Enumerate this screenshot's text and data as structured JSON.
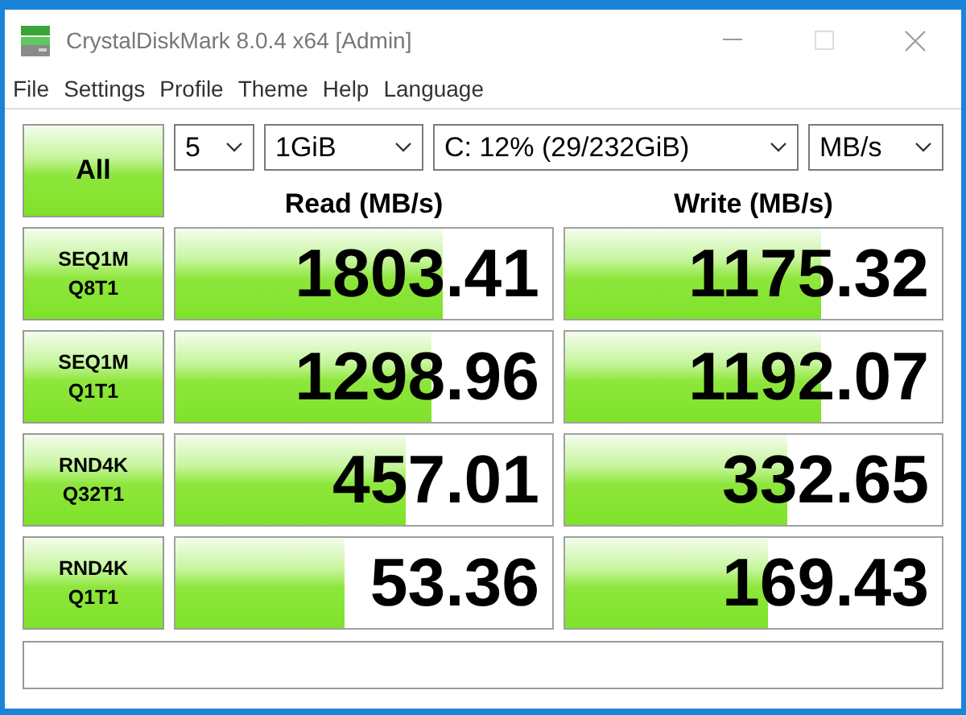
{
  "window": {
    "title": "CrystalDiskMark 8.0.4 x64 [Admin]"
  },
  "menu": [
    "File",
    "Settings",
    "Profile",
    "Theme",
    "Help",
    "Language"
  ],
  "all_button": "All",
  "selects": [
    {
      "value": "5"
    },
    {
      "value": "1GiB"
    },
    {
      "value": "C: 12% (29/232GiB)"
    },
    {
      "value": "MB/s"
    }
  ],
  "columns": [
    "Read (MB/s)",
    "Write (MB/s)"
  ],
  "rows": [
    {
      "test": [
        "SEQ1M",
        "Q8T1"
      ],
      "read": {
        "value": "1803.41",
        "level": 0.71
      },
      "write": {
        "value": "1175.32",
        "level": 0.68
      }
    },
    {
      "test": [
        "SEQ1M",
        "Q1T1"
      ],
      "read": {
        "value": "1298.96",
        "level": 0.68
      },
      "write": {
        "value": "1192.07",
        "level": 0.68
      }
    },
    {
      "test": [
        "RND4K",
        "Q32T1"
      ],
      "read": {
        "value": "457.01",
        "level": 0.61
      },
      "write": {
        "value": "332.65",
        "level": 0.59
      }
    },
    {
      "test": [
        "RND4K",
        "Q1T1"
      ],
      "read": {
        "value": "53.36",
        "level": 0.45
      },
      "write": {
        "value": "169.43",
        "level": 0.54
      }
    }
  ]
}
